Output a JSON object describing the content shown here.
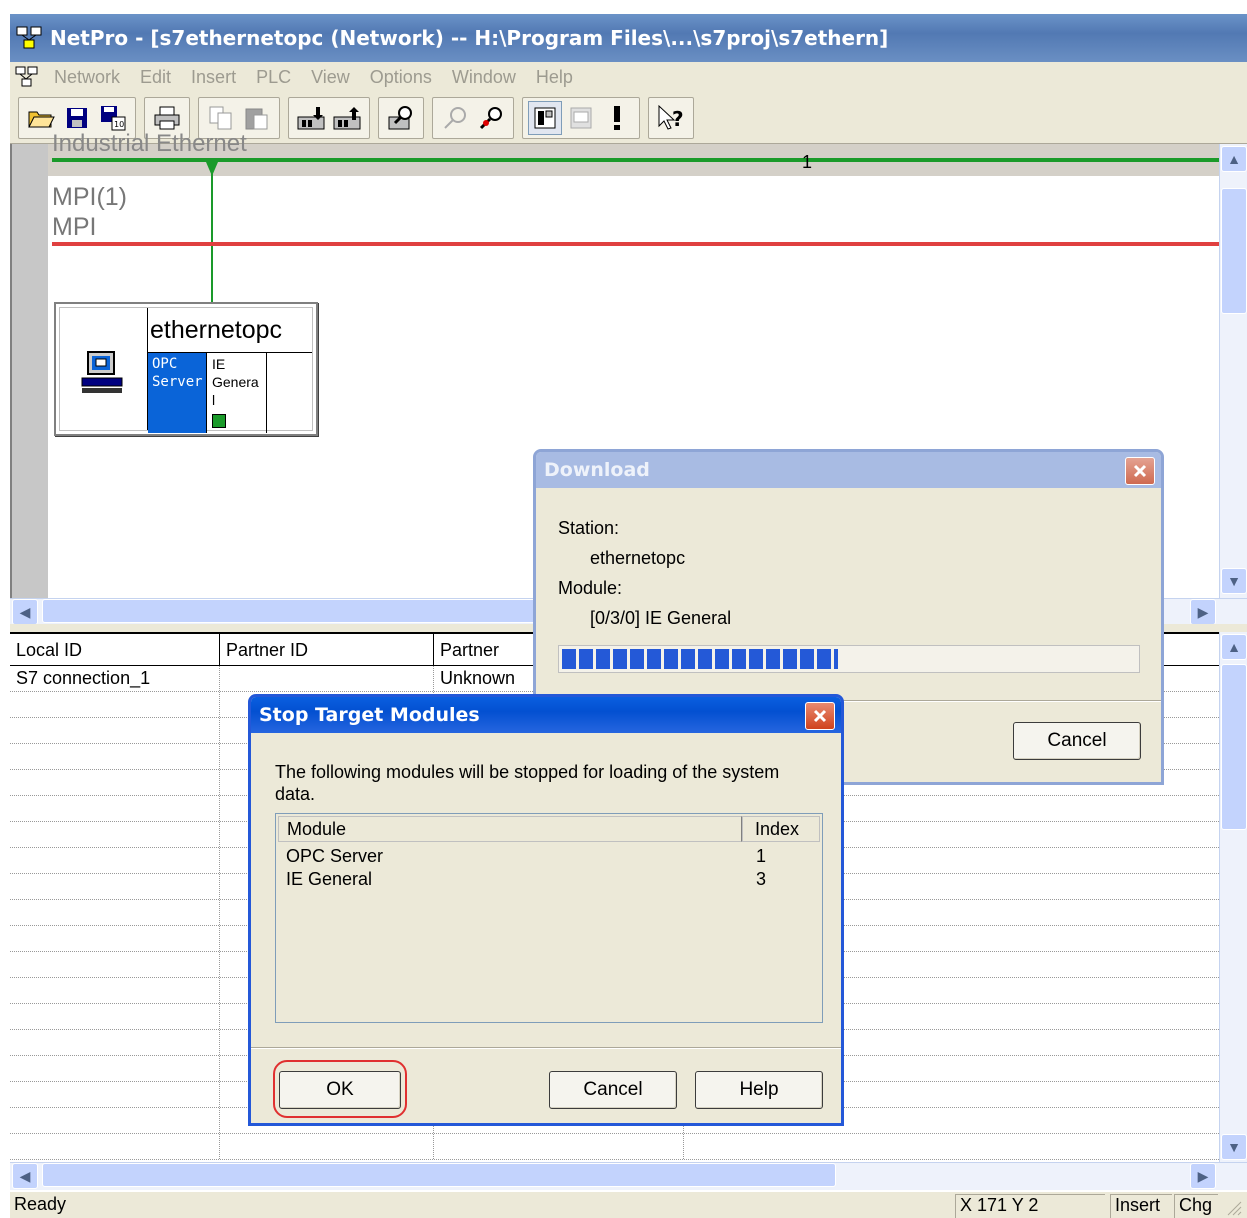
{
  "window": {
    "title": "NetPro - [s7ethernetopc (Network) -- H:\\Program Files\\...\\s7proj\\s7ethern]"
  },
  "menu": [
    "Network",
    "Edit",
    "Insert",
    "PLC",
    "View",
    "Options",
    "Window",
    "Help"
  ],
  "toolbar": {
    "icons": [
      "open-icon",
      "save-icon",
      "save-compile-icon",
      "print-icon",
      "copy-icon",
      "paste-icon",
      "download-icon",
      "upload-icon",
      "diagnose-icon",
      "disabled-tool-icon",
      "connection-tool-icon",
      "display-toggle-icon",
      "station-view-icon",
      "exclamation-icon",
      "help-pointer-icon"
    ],
    "help_label": "?"
  },
  "network": {
    "ie_label": "Industrial Ethernet",
    "ie_number": "1",
    "mpi_label_1": "MPI(1)",
    "mpi_label_2": "MPI",
    "station_name": "ethernetopc",
    "slot_opc_1": "OPC",
    "slot_opc_2": "Server",
    "slot_ie_1": "IE",
    "slot_ie_2": "Genera",
    "slot_ie_3": "l",
    "colors": {
      "ethernet": "#1a9a2a",
      "mpi": "#e04040"
    }
  },
  "table": {
    "columns": [
      "Local ID",
      "Partner ID",
      "Partner"
    ],
    "rows": [
      {
        "local_id": "S7 connection_1",
        "partner_id": "",
        "partner": "Unknown"
      }
    ]
  },
  "statusbar": {
    "text": "Ready",
    "coords": "X 171   Y 2",
    "mode": "Insert",
    "chg": "Chg"
  },
  "download_dialog": {
    "title": "Download",
    "station_label": "Station:",
    "station_value": "ethernetopc",
    "module_label": "Module:",
    "module_value": "[0/3/0] IE General",
    "progress": 0.48,
    "cancel_label": "Cancel"
  },
  "stop_dialog": {
    "title": "Stop Target Modules",
    "message": "The following modules will be stopped for loading of the system data.",
    "columns": [
      "Module",
      "Index"
    ],
    "rows": [
      {
        "module": "OPC Server",
        "index": "1"
      },
      {
        "module": "IE General",
        "index": "3"
      }
    ],
    "ok_label": "OK",
    "cancel_label": "Cancel",
    "help_label": "Help"
  }
}
